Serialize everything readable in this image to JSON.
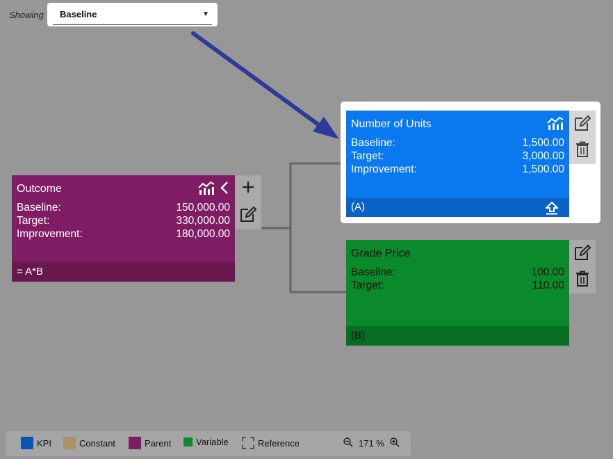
{
  "header": {
    "showing_label": "Showing",
    "dropdown_value": "Baseline"
  },
  "cards": {
    "outcome": {
      "title": "Outcome",
      "rows": [
        {
          "label": "Baseline:",
          "value": "150,000.00"
        },
        {
          "label": "Target:",
          "value": "330,000.00"
        },
        {
          "label": "Improvement:",
          "value": "180,000.00"
        }
      ],
      "footer": "= A*B",
      "color": "#7e1d64",
      "footer_color": "#68174f"
    },
    "units": {
      "title": "Number of Units",
      "rows": [
        {
          "label": "Baseline:",
          "value": "1,500.00"
        },
        {
          "label": "Target:",
          "value": "3,000.00"
        },
        {
          "label": "Improvement:",
          "value": "1,500.00"
        }
      ],
      "footer": "(A)",
      "color": "#0a78ef",
      "footer_color": "#0a63c7"
    },
    "grade": {
      "title": "Grade Price",
      "rows": [
        {
          "label": "Baseline:",
          "value": "100.00"
        },
        {
          "label": "Target:",
          "value": "110.00"
        }
      ],
      "footer": "(B)",
      "color": "#0a8a2a",
      "footer_color": "#076d21"
    }
  },
  "legend": {
    "items": [
      {
        "label": "KPI",
        "color": "#0a55b3"
      },
      {
        "label": "Constant",
        "color": "#ab9367"
      },
      {
        "label": "Parent",
        "color": "#7e1d64"
      },
      {
        "label": "Variable",
        "color": "#0a8a2a"
      },
      {
        "label": "Reference",
        "color": "dashed"
      }
    ],
    "zoom_level": "171 %"
  },
  "colors": {
    "background": "#979797",
    "arrow": "#2e3a9a"
  }
}
